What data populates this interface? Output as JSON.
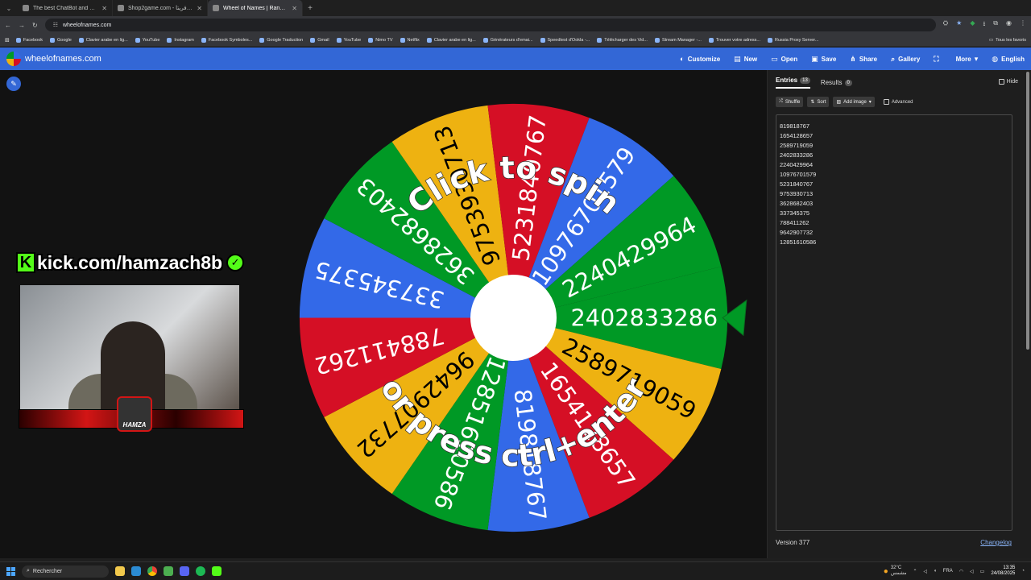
{
  "browser": {
    "tabs": [
      {
        "title": "The best ChatBot and Widgets",
        "active": false
      },
      {
        "title": "Shop2game.com - إشحن أفريتا",
        "active": false
      },
      {
        "title": "Wheel of Names | Random nam",
        "active": true
      }
    ],
    "url": "wheelofnames.com",
    "bookmarks": [
      "Facebook",
      "Google",
      "Clavier arabe en lig...",
      "YouTube",
      "Instagram",
      "Facebook Symboles...",
      "Google Traduction",
      "Gmail",
      "YouTube",
      "Nimo TV",
      "Netflix",
      "Clavier arabe en lig...",
      "Générateurs d'emai...",
      "Speedtest d'Ookla -...",
      "Télécharger des Vid...",
      "Stream Manager -...",
      "Trouver votre adress...",
      "Russia Proxy Server..."
    ],
    "all_bookmarks": "Tous les favoris"
  },
  "header": {
    "site_name": "wheelofnames.com",
    "menu": [
      {
        "label": "Customize",
        "icon": "palette-icon",
        "glyph": "◐"
      },
      {
        "label": "New",
        "icon": "new-file-icon",
        "glyph": "▤"
      },
      {
        "label": "Open",
        "icon": "folder-icon",
        "glyph": "▭"
      },
      {
        "label": "Save",
        "icon": "save-icon",
        "glyph": "▣"
      },
      {
        "label": "Share",
        "icon": "share-icon",
        "glyph": "⋔"
      },
      {
        "label": "Gallery",
        "icon": "search-icon",
        "glyph": "⌕"
      },
      {
        "label": "",
        "icon": "fullscreen-icon",
        "glyph": "⛶"
      },
      {
        "label": "More",
        "icon": "chevron-down-icon",
        "glyph": "▾"
      },
      {
        "label": "English",
        "icon": "globe-icon",
        "glyph": "◍"
      }
    ]
  },
  "wheel": {
    "segments": [
      "2402833286",
      "2589719059",
      "1654128657",
      "819818767",
      "12851610586",
      "9642907732",
      "788411262",
      "337345375",
      "3628682403",
      "9753930713",
      "5231840767",
      "10976701579",
      "2240429964"
    ],
    "colors": [
      "#009925",
      "#eeb211",
      "#d50f25",
      "#3369e8"
    ],
    "prompt_top": "Click to spin",
    "prompt_bottom": "or press ctrl+enter"
  },
  "stream": {
    "kick_logo": "K",
    "kick_url": "kick.com/hamzach8b",
    "streamer_tag": "HAMZA"
  },
  "panel": {
    "tabs": [
      {
        "label": "Entries",
        "count": "13"
      },
      {
        "label": "Results",
        "count": "0"
      }
    ],
    "hide_label": "Hide",
    "tools": {
      "shuffle": "Shuffle",
      "sort": "Sort",
      "add_image": "Add image",
      "advanced": "Advanced"
    },
    "entries": [
      "819818767",
      "1654128657",
      "2589719059",
      "2402833286",
      "2240429964",
      "10976701579",
      "5231840767",
      "9753930713",
      "3628682403",
      "337345375",
      "788411262",
      "9642907732",
      "12851610586"
    ],
    "version": "Version 377",
    "changelog": "Changelog"
  },
  "taskbar": {
    "search_placeholder": "Rechercher",
    "weather_temp": "32°C",
    "weather_desc": "مشمس",
    "lang": "FRA",
    "time": "13:35",
    "date": "24/08/2025"
  }
}
